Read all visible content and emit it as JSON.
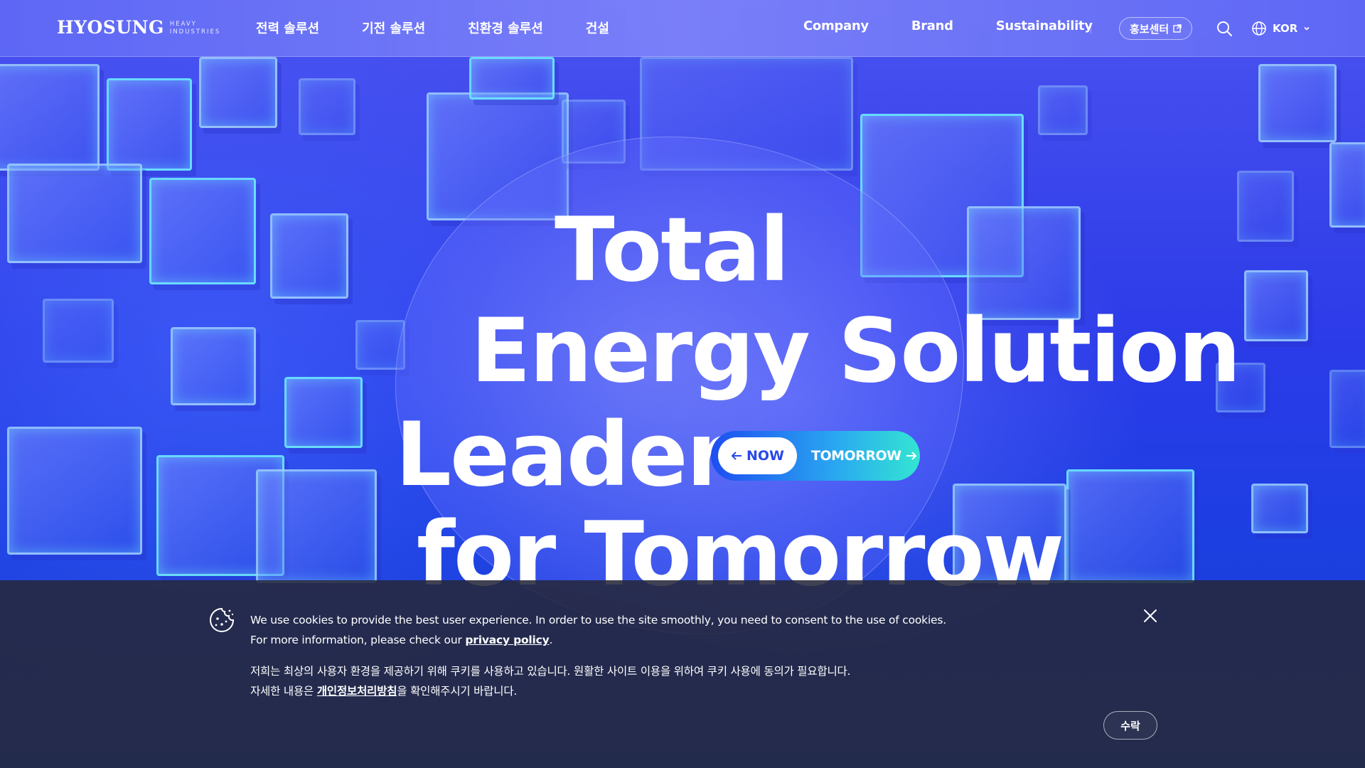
{
  "header": {
    "logo": {
      "main": "HYOSUNG",
      "sub_line1": "HEAVY",
      "sub_line2": "INDUSTRIES"
    },
    "nav_left": [
      "전력 솔루션",
      "기전 솔루션",
      "친환경 솔루션",
      "건설"
    ],
    "nav_right": [
      "Company",
      "Brand",
      "Sustainability"
    ],
    "pr_center_label": "홍보센터",
    "language_label": "KOR"
  },
  "hero": {
    "line1": "Total",
    "line2": "Energy Solution",
    "line3": "Leader",
    "line4": "for Tomorrow",
    "toggle": {
      "now_label": "NOW",
      "tomorrow_label": "TOMORROW"
    }
  },
  "cookie_banner": {
    "en_line1": "We use cookies to provide the best user experience. In order to use the site smoothly, you need to consent to the use of cookies.",
    "en_line2_prefix": "For more information, please check our ",
    "en_link": "privacy policy",
    "en_line2_suffix": ".",
    "ko_line1": "저희는 최상의 사용자 환경을 제공하기 위해 쿠키를 사용하고 있습니다. 원활한 사이트 이용을 위하여 쿠키 사용에 동의가 필요합니다.",
    "ko_line2_prefix": "자세한 내용은 ",
    "ko_link": "개인정보처리방침",
    "ko_line2_suffix": "을 확인해주시기 바랍니다.",
    "accept_label": "수락"
  },
  "colors": {
    "hero_blue": "#2b3be8",
    "toggle_start": "#1d4ef0",
    "toggle_end": "#33e6d2",
    "cookie_bg": "#26283a"
  },
  "icons": [
    "cookie-icon",
    "external-link-icon",
    "search-icon",
    "globe-icon",
    "chevron-down-icon",
    "close-icon",
    "arrow-left-icon",
    "arrow-right-icon"
  ]
}
